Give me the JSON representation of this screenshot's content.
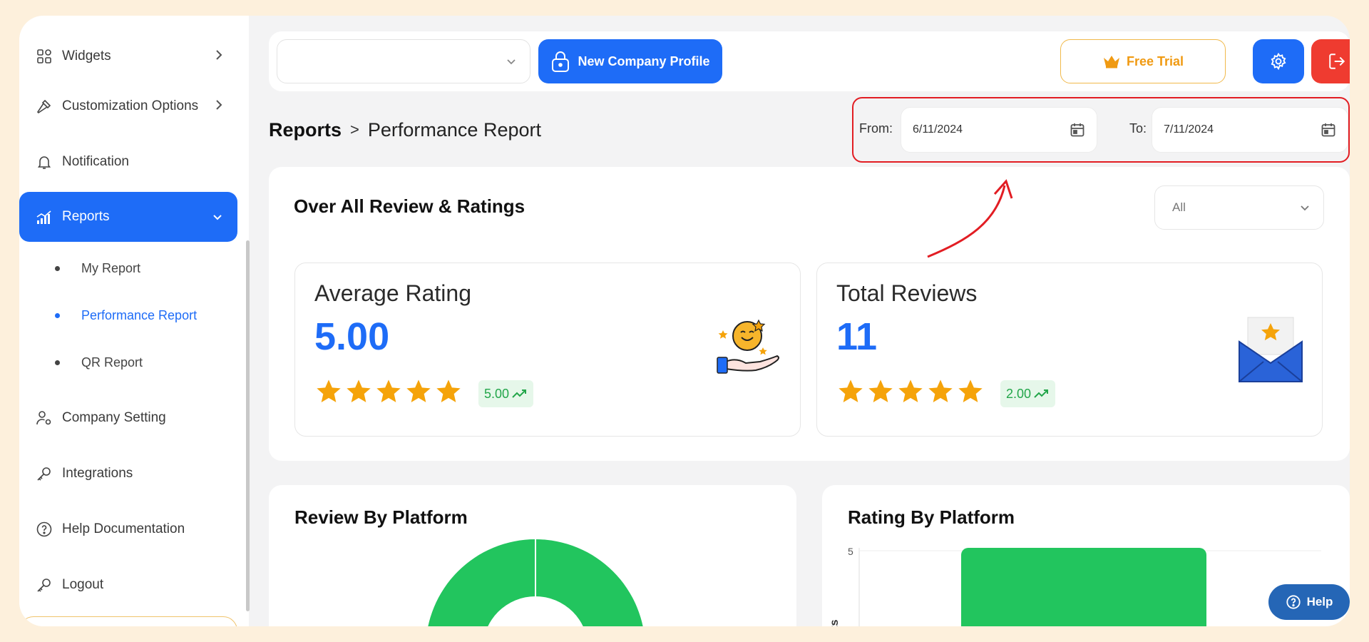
{
  "sidebar": {
    "items": [
      {
        "label": "Widgets",
        "icon": "grid-icon"
      },
      {
        "label": "Customization Options",
        "icon": "hammer-icon"
      },
      {
        "label": "Notification",
        "icon": "bell-icon"
      },
      {
        "label": "Reports",
        "icon": "chart-icon"
      },
      {
        "label": "Company Setting",
        "icon": "user-gear-icon"
      },
      {
        "label": "Integrations",
        "icon": "key-icon"
      },
      {
        "label": "Help Documentation",
        "icon": "question-circle-icon"
      },
      {
        "label": "Logout",
        "icon": "key-icon"
      }
    ],
    "sub_items": [
      {
        "label": "My Report"
      },
      {
        "label": "Performance Report"
      },
      {
        "label": "QR Report"
      }
    ]
  },
  "topbar": {
    "company_select_value": "",
    "new_company_label": "New Company Profile",
    "free_trial_label": "Free Trial"
  },
  "breadcrumb": {
    "root": "Reports",
    "separator": ">",
    "current": "Performance Report"
  },
  "date_range": {
    "from_label": "From:",
    "from_value": "6/11/2024",
    "to_label": "To:",
    "to_value": "7/11/2024"
  },
  "overview": {
    "title": "Over All Review & Ratings",
    "filter_value": "All",
    "average_rating": {
      "label": "Average Rating",
      "value": "5.00",
      "stars": 5,
      "trend": "5.00"
    },
    "total_reviews": {
      "label": "Total Reviews",
      "value": "11",
      "stars": 5,
      "trend": "2.00"
    }
  },
  "platform": {
    "review_title": "Review By Platform",
    "rating_title": "Rating By Platform",
    "rating_axis_tick": "5",
    "rating_axis_label": "ounts"
  },
  "help": {
    "label": "Help"
  },
  "colors": {
    "primary": "#1e6cf7",
    "danger": "#ef3b30",
    "trial": "#f09a12",
    "star": "#f5a30a",
    "chart_green": "#22c55e"
  }
}
